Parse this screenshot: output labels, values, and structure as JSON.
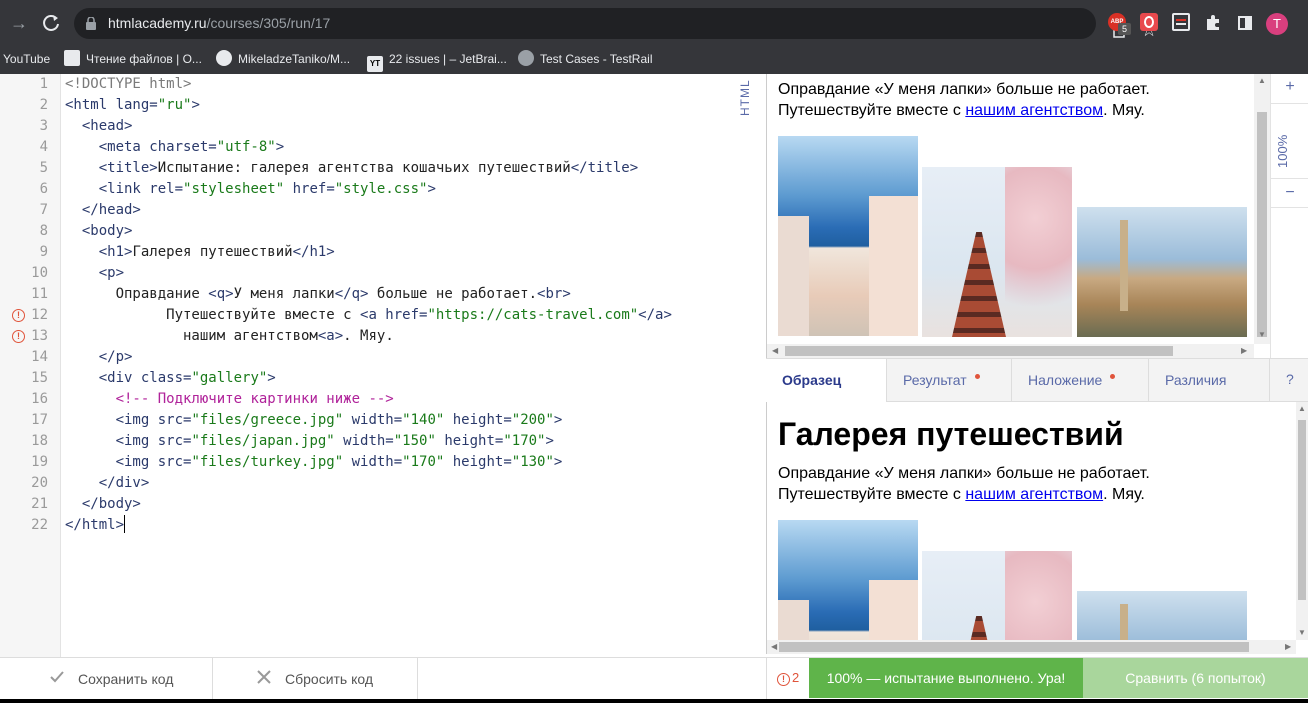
{
  "browser": {
    "url_domain": "htmlacademy.ru",
    "url_path": "/courses/305/run/17",
    "extensions": {
      "abp_label": "ABP",
      "abp_badge": "5",
      "profile_initial": "T"
    },
    "bookmarks": [
      "YouTube",
      "Чтение файлов | О...",
      "MikeladzeTaniko/M...",
      "22 issues | – JetBrai...",
      "Test Cases - TestRail"
    ],
    "bookmark_icons": {
      "jetbrains": "YT"
    }
  },
  "editor": {
    "mode_label": "HTML",
    "line_numbers": [
      "1",
      "2",
      "3",
      "4",
      "5",
      "6",
      "7",
      "8",
      "9",
      "10",
      "11",
      "12",
      "13",
      "14",
      "15",
      "16",
      "17",
      "18",
      "19",
      "20",
      "21",
      "22"
    ],
    "warning_glyph": "!",
    "lines": [
      {
        "indent": "",
        "tag": "<!DOCTYPE html>"
      },
      {
        "pre": "<html lang=",
        "str": "\"ru\"",
        "post": ">"
      },
      {
        "indent": "  ",
        "tag": "<head>"
      },
      {
        "pre": "    <meta charset=",
        "str": "\"utf-8\"",
        "post": ">"
      },
      {
        "tag_open": "    <title>",
        "text": "Испытание: галерея агентства кошачьих путешествий",
        "tag_close": "</title>"
      },
      {
        "pre": "    <link rel=",
        "str": "\"stylesheet\"",
        "mid": " href=",
        "str2": "\"style.css\"",
        "post": ">"
      },
      {
        "indent": "  ",
        "tag": "</head>"
      },
      {
        "indent": "  ",
        "tag": "<body>"
      },
      {
        "tag_open": "    <h1>",
        "text": "Галерея путешествий",
        "tag_close": "</h1>"
      },
      {
        "indent": "    ",
        "tag": "<p>"
      },
      {
        "text1": "      Оправдание ",
        "tag1": "<q>",
        "text2": "У меня лапки",
        "tag2": "</q>",
        "text3": " больше не работает.",
        "tag3": "<br>"
      },
      {
        "text1": "            Путешествуйте вместе с ",
        "pre": "<a href=",
        "str": "\"https://cats-travel.com\"",
        "post": "</a>"
      },
      {
        "text1": "              нашим агентством",
        "tag1": "<a>",
        "text2": ". Мяу."
      },
      {
        "indent": "    ",
        "tag": "</p>"
      },
      {
        "pre": "    <div class=",
        "str": "\"gallery\"",
        "post": ">"
      },
      {
        "indent": "      ",
        "comment": "<!-- Подключите картинки ниже -->"
      },
      {
        "pre": "      <img src=",
        "str": "\"files/greece.jpg\"",
        "mid": " width=",
        "str2": "\"140\"",
        "mid2": " height=",
        "str3": "\"200\"",
        "post": ">"
      },
      {
        "pre": "      <img src=",
        "str": "\"files/japan.jpg\"",
        "mid": " width=",
        "str2": "\"150\"",
        "mid2": " height=",
        "str3": "\"170\"",
        "post": ">"
      },
      {
        "pre": "      <img src=",
        "str": "\"files/turkey.jpg\"",
        "mid": " width=",
        "str2": "\"170\"",
        "mid2": " height=",
        "str3": "\"130\"",
        "post": ">"
      },
      {
        "indent": "    ",
        "tag": "</div>"
      },
      {
        "indent": "  ",
        "tag": "</body>"
      },
      {
        "indent": "",
        "tag": "</html>"
      },
      {
        "indent": "",
        "tag": ""
      }
    ]
  },
  "preview": {
    "h1": "Галерея путешествий",
    "line1": "Оправдание «У меня лапки» больше не работает.",
    "line2_pre": "Путешествуйте вместе с ",
    "line2_link": "нашим агентством",
    "line2_post": ". Мяу."
  },
  "zoom": {
    "plus": "+",
    "value": "100%",
    "minus": "−"
  },
  "tabs": [
    {
      "label": "Образец",
      "active": true,
      "dot": false
    },
    {
      "label": "Результат",
      "active": false,
      "dot": true
    },
    {
      "label": "Наложение",
      "active": false,
      "dot": true
    },
    {
      "label": "Различия",
      "active": false,
      "dot": false
    }
  ],
  "help": "?",
  "footer": {
    "save": "Сохранить код",
    "reset": "Сбросить код",
    "error_count": "2",
    "success": "100% — испытание выполнено. Ура!",
    "compare": "Сравнить (6 попыток)"
  },
  "colors": {
    "success": "#5fb44a",
    "compare": "#a9d69c",
    "warning": "#e0543b",
    "accent": "#5a6aa8"
  }
}
